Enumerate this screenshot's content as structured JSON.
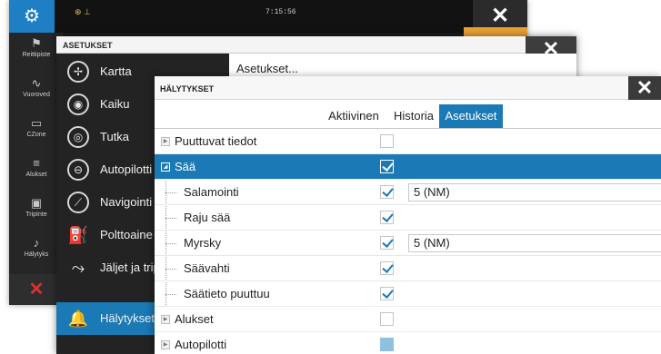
{
  "back_window": {
    "clock": "7:15:56",
    "status_icons": "⊕ ⊥",
    "sidebar": [
      {
        "label": "Reittipiste",
        "icon": "flag-icon"
      },
      {
        "label": "Vuoroved",
        "icon": "tide-icon"
      },
      {
        "label": "CZone",
        "icon": "czone-icon"
      },
      {
        "label": "Alukset",
        "icon": "vessels-icon"
      },
      {
        "label": "TripInte",
        "icon": "trip-icon"
      },
      {
        "label": "Hälytyks",
        "icon": "bell-icon"
      }
    ],
    "colors": {
      "gear_bg": "#1f7fc4",
      "cancel": "#e0302f"
    }
  },
  "settings_window": {
    "title": "ASETUKSET",
    "right_title": "Asetukset...",
    "menu": [
      {
        "label": "Kartta",
        "icon": "chart-icon",
        "active": false
      },
      {
        "label": "Kaiku",
        "icon": "echo-icon",
        "active": false
      },
      {
        "label": "Tutka",
        "icon": "radar-icon",
        "active": false
      },
      {
        "label": "Autopilotti",
        "icon": "steering-wheel-icon",
        "active": false
      },
      {
        "label": "Navigointi",
        "icon": "compass-icon",
        "active": false
      },
      {
        "label": "Polttoaine",
        "icon": "fuel-pump-icon",
        "active": false
      },
      {
        "label": "Jäljet ja trip",
        "icon": "trails-icon",
        "active": false
      },
      {
        "label": "Hälytykset",
        "icon": "bell-icon",
        "active": true
      }
    ]
  },
  "alarms_dialog": {
    "title": "HÄLYTYKSET",
    "tabs": [
      {
        "label": "Aktiivinen",
        "active": false
      },
      {
        "label": "Historia",
        "active": false
      },
      {
        "label": "Asetukset",
        "active": true
      }
    ],
    "rows": [
      {
        "label": "Puuttuvat tiedot",
        "level": 0,
        "expander": "closed",
        "checked": false,
        "value": ""
      },
      {
        "label": "Sää",
        "level": 0,
        "expander": "open",
        "checked": true,
        "value": "",
        "selected": true
      },
      {
        "label": "Salamointi",
        "level": 1,
        "checked": true,
        "value": "5 (NM)"
      },
      {
        "label": "Raju sää",
        "level": 1,
        "checked": true,
        "value": ""
      },
      {
        "label": "Myrsky",
        "level": 1,
        "checked": true,
        "value": "5 (NM)"
      },
      {
        "label": "Säävahti",
        "level": 1,
        "checked": true,
        "value": ""
      },
      {
        "label": "Säätieto puuttuu",
        "level": 1,
        "checked": true,
        "value": ""
      },
      {
        "label": "Alukset",
        "level": 0,
        "expander": "closed",
        "checked": false,
        "value": ""
      },
      {
        "label": "Autopilotti",
        "level": 0,
        "expander": "closed",
        "checked": false,
        "disabled": true,
        "value": ""
      }
    ],
    "accent": "#1b79b5"
  }
}
